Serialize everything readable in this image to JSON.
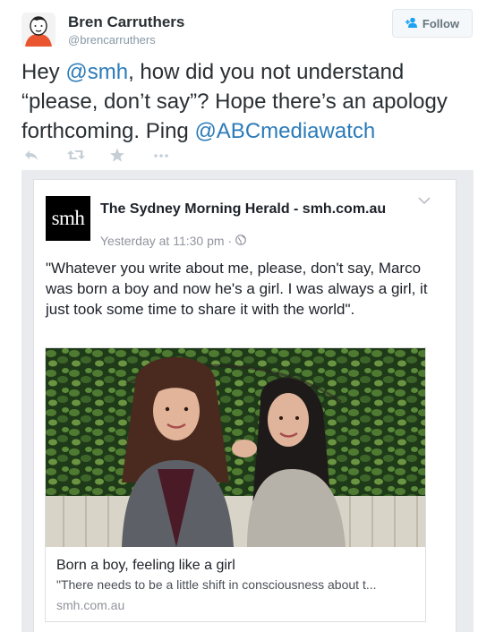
{
  "tweet": {
    "author_name": "Bren Carruthers",
    "author_handle": "@brencarruthers",
    "follow_label": "Follow",
    "text_part1": "Hey ",
    "mention1": "@smh",
    "text_part2": ", how did you not understand “please, don’t say”? Hope there’s an apology forthcoming. Ping ",
    "mention2": "@ABCmediawatch",
    "actions": [
      "reply-icon",
      "retweet-icon",
      "favorite-icon",
      "more-icon"
    ]
  },
  "facebook_post": {
    "page_name": "The Sydney Morning Herald - smh.com.au",
    "logo_text": "smh",
    "timestamp": "Yesterday at 11:30 pm",
    "separator": "·",
    "privacy_icon": "globe-icon",
    "body": "\"Whatever you write about me, please, don't say, Marco was born a boy and now he's a girl. I was always a girl, it just took some time to share it with the world\".",
    "link": {
      "title": "Born a boy, feeling like a girl",
      "description": "\"There needs to be a little shift in consciousness about t...",
      "domain": "smh.com.au"
    }
  },
  "colors": {
    "mention": "#2b7bb9",
    "text": "#292f33",
    "muted": "#8899a6",
    "embed_background": "#e9ebee"
  }
}
